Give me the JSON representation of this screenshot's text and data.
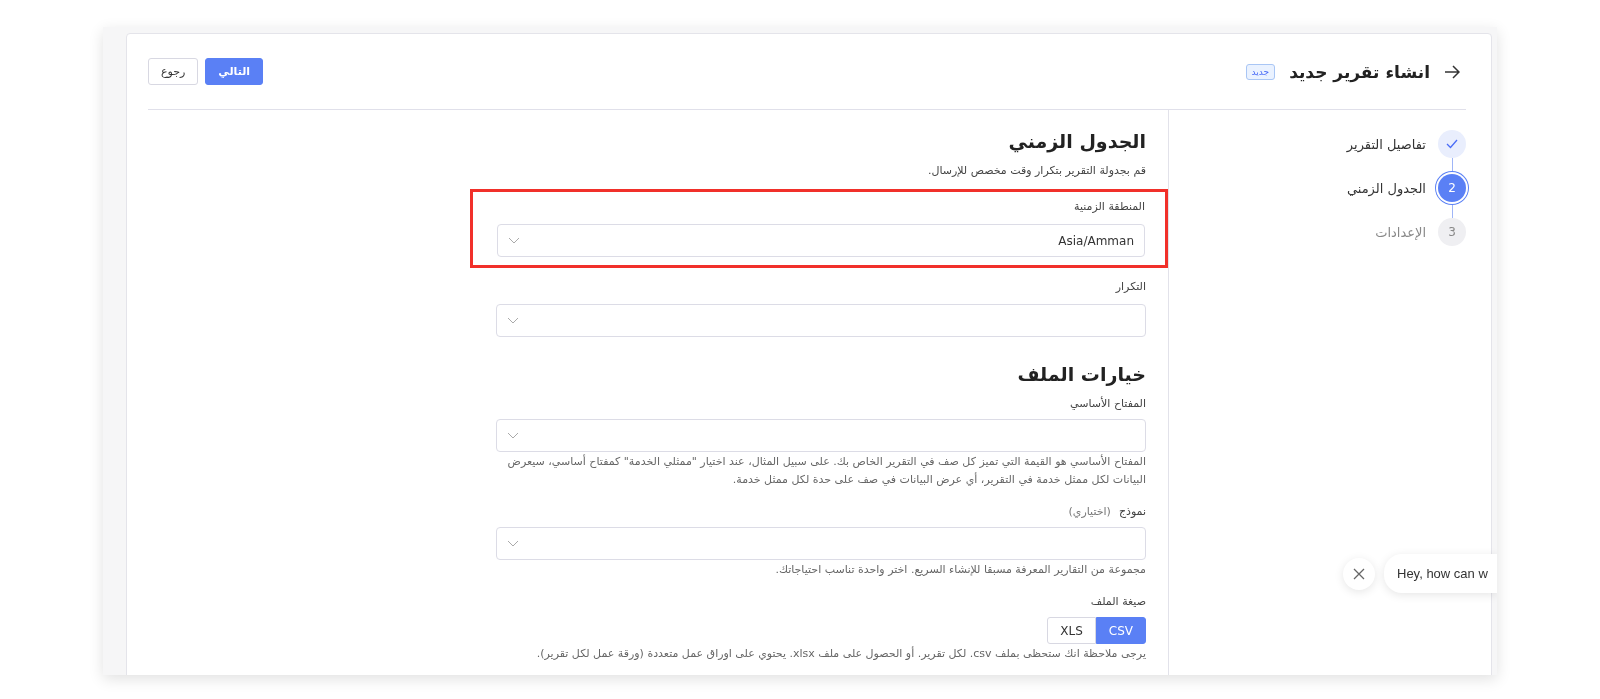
{
  "header": {
    "title": "انشاء تقرير جديد",
    "badge": "جديد",
    "buttons": [
      {
        "label": "التالي",
        "kind": "primary"
      },
      {
        "label": "رجوع",
        "kind": "secondary"
      }
    ]
  },
  "steps": [
    {
      "label": "تفاصيل التقرير",
      "done": true,
      "selected": false
    },
    {
      "label": "الجدول الزمني",
      "number": "2",
      "done": false,
      "selected": true
    },
    {
      "label": "الإعدادات",
      "number": "3",
      "done": false,
      "selected": false
    }
  ],
  "sections": [
    {
      "title": "الجدول الزمني",
      "description": "قم بجدولة التقرير بتكرار وقت مخصص للإرسال.",
      "fields": [
        {
          "kind": "select",
          "label": "المنطقة الزمنية",
          "value": "Asia/Amman",
          "highlighted": true
        },
        {
          "kind": "select",
          "label": "التكرار",
          "highlighted": false
        }
      ]
    },
    {
      "title": "خيارات الملف",
      "fields": [
        {
          "kind": "select",
          "label": "المفتاح الأساسي",
          "highlighted": false,
          "help": "المفتاح الأساسي هو القيمة التي تميز كل صف في التقرير الخاص بك. على سبيل المثال، عند اختيار \"ممثلي الخدمة\" كمفتاح أساسي، سيعرض البيانات لكل ممثل خدمة في التقرير، أي عرض البيانات في صف على حدة لكل ممثل خدمة."
        },
        {
          "kind": "select",
          "label": "نموذج",
          "optional": "(اختياري)",
          "highlighted": false,
          "help": "مجموعة من التقارير المعرفة مسبقا للإنشاء السريع. اختر واحدة تناسب احتياجاتك."
        },
        {
          "kind": "segmented",
          "label": "صيغة الملف",
          "highlighted": false,
          "options": [
            {
              "label": "CSV",
              "selected": true
            },
            {
              "label": "XLS",
              "selected": false
            }
          ],
          "help": "يرجى ملاحظة انك ستحظى بملف csv. لكل تقرير. أو الحصول على ملف xlsx. يحتوي على اوراق عمل متعددة (ورقة عمل لكل تقرير)."
        }
      ]
    }
  ],
  "chat": {
    "message": "Hey, how can w"
  }
}
